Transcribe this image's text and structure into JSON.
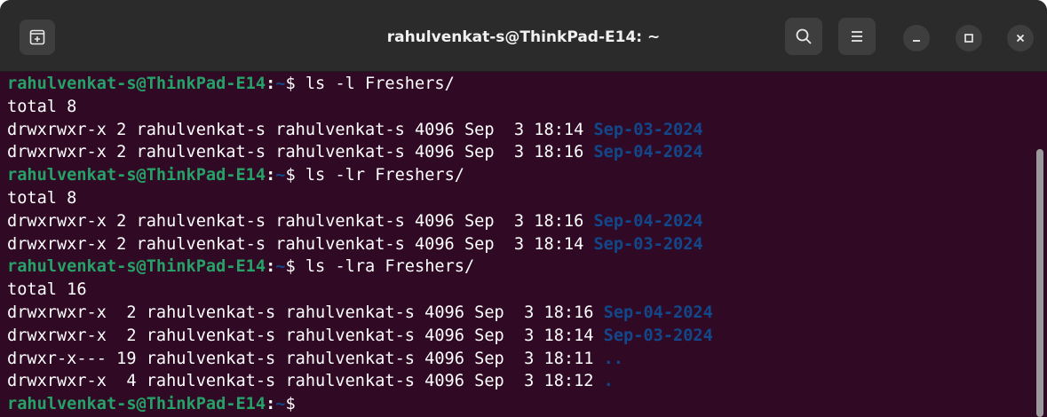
{
  "window": {
    "title": "rahulvenkat-s@ThinkPad-E14: ~"
  },
  "titlebar": {
    "icons": {
      "new_tab": "new-tab-icon",
      "search": "search-icon",
      "menu": "hamburger-menu-icon",
      "minimize": "minimize-icon",
      "maximize": "maximize-icon",
      "close": "close-icon"
    }
  },
  "colors": {
    "terminal_bg": "#300a24",
    "prompt_user": "#26a269",
    "directory": "#12488b",
    "text": "#ffffff",
    "titlebar_bg": "#2b2b2b"
  },
  "terminal": {
    "prompt": {
      "user": "rahulvenkat-s@ThinkPad-E14",
      "colon": ":",
      "path": "~",
      "dollar": "$"
    },
    "lines": [
      {
        "type": "prompt",
        "command": " ls -l Freshers/"
      },
      {
        "type": "text",
        "text": "total 8"
      },
      {
        "type": "entry",
        "text": "drwxrwxr-x 2 rahulvenkat-s rahulvenkat-s 4096 Sep  3 18:14 ",
        "name": "Sep-03-2024"
      },
      {
        "type": "entry",
        "text": "drwxrwxr-x 2 rahulvenkat-s rahulvenkat-s 4096 Sep  3 18:16 ",
        "name": "Sep-04-2024"
      },
      {
        "type": "prompt",
        "command": " ls -lr Freshers/"
      },
      {
        "type": "text",
        "text": "total 8"
      },
      {
        "type": "entry",
        "text": "drwxrwxr-x 2 rahulvenkat-s rahulvenkat-s 4096 Sep  3 18:16 ",
        "name": "Sep-04-2024"
      },
      {
        "type": "entry",
        "text": "drwxrwxr-x 2 rahulvenkat-s rahulvenkat-s 4096 Sep  3 18:14 ",
        "name": "Sep-03-2024"
      },
      {
        "type": "prompt",
        "command": " ls -lra Freshers/"
      },
      {
        "type": "text",
        "text": "total 16"
      },
      {
        "type": "entry",
        "text": "drwxrwxr-x  2 rahulvenkat-s rahulvenkat-s 4096 Sep  3 18:16 ",
        "name": "Sep-04-2024"
      },
      {
        "type": "entry",
        "text": "drwxrwxr-x  2 rahulvenkat-s rahulvenkat-s 4096 Sep  3 18:14 ",
        "name": "Sep-03-2024"
      },
      {
        "type": "entry",
        "text": "drwxr-x--- 19 rahulvenkat-s rahulvenkat-s 4096 Sep  3 18:11 ",
        "name": ".."
      },
      {
        "type": "entry",
        "text": "drwxrwxr-x  4 rahulvenkat-s rahulvenkat-s 4096 Sep  3 18:12 ",
        "name": "."
      },
      {
        "type": "prompt",
        "command": ""
      }
    ]
  }
}
